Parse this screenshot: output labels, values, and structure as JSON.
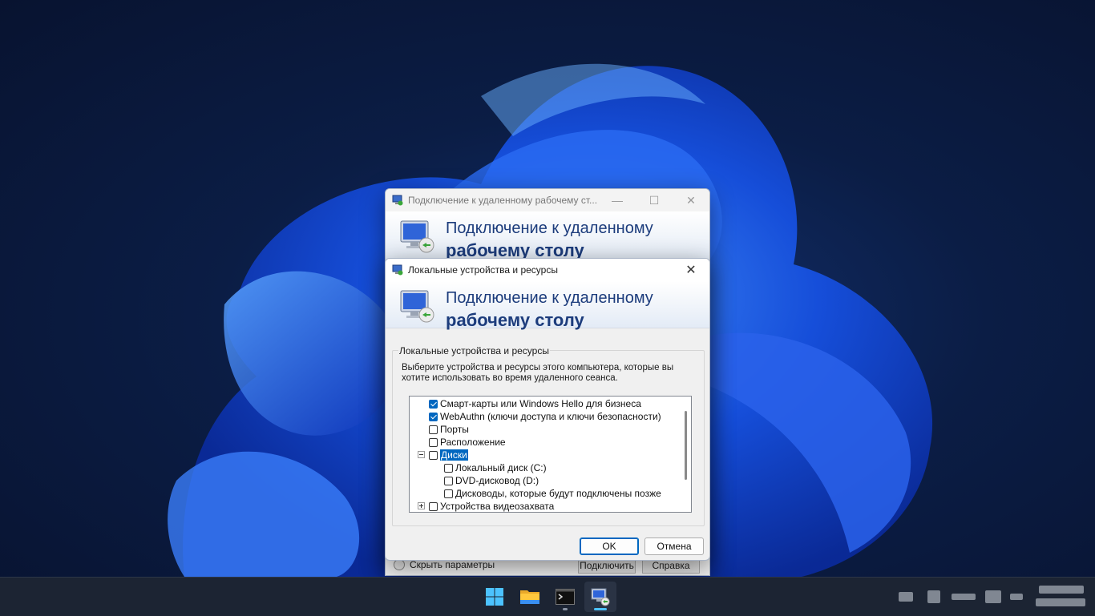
{
  "back_window": {
    "title": "Подключение к удаленному рабочему ст...",
    "banner_line1": "Подключение к удаленному",
    "banner_line2": "рабочему столу",
    "hide_options_label": "Скрыть параметры",
    "connect_label": "Подключить",
    "help_label": "Справка"
  },
  "dialog": {
    "title": "Локальные устройства и ресурсы",
    "banner_line1": "Подключение к удаленному",
    "banner_line2": "рабочему столу",
    "group_label": "Локальные устройства и ресурсы",
    "description": "Выберите устройства и ресурсы этого компьютера, которые вы хотите использовать во время удаленного сеанса.",
    "tree_items": [
      {
        "label": "Смарт-карты или Windows Hello для бизнеса",
        "checked": true,
        "level": 0,
        "expander": "none"
      },
      {
        "label": "WebAuthn (ключи доступа и ключи безопасности)",
        "checked": true,
        "level": 0,
        "expander": "none"
      },
      {
        "label": "Порты",
        "checked": false,
        "level": 0,
        "expander": "none"
      },
      {
        "label": "Расположение",
        "checked": false,
        "level": 0,
        "expander": "none"
      },
      {
        "label": "Диски",
        "checked": false,
        "level": 0,
        "expander": "minus",
        "selected": true
      },
      {
        "label": "Локальный диск (C:)",
        "checked": false,
        "level": 1,
        "expander": "none"
      },
      {
        "label": "DVD-дисковод (D:)",
        "checked": false,
        "level": 1,
        "expander": "none"
      },
      {
        "label": "Дисководы, которые будут подключены позже",
        "checked": false,
        "level": 1,
        "expander": "none"
      },
      {
        "label": "Устройства видеозахвата",
        "checked": false,
        "level": 0,
        "expander": "plus"
      }
    ],
    "ok_label": "OK",
    "cancel_label": "Отмена"
  },
  "taskbar": {
    "items": [
      {
        "name": "start-icon"
      },
      {
        "name": "file-explorer-icon"
      },
      {
        "name": "terminal-icon"
      },
      {
        "name": "remote-desktop-icon",
        "active": true
      }
    ]
  },
  "colors": {
    "accent": "#0067c0",
    "banner_text": "#1c3c7c",
    "taskbar": "#1c2433"
  }
}
